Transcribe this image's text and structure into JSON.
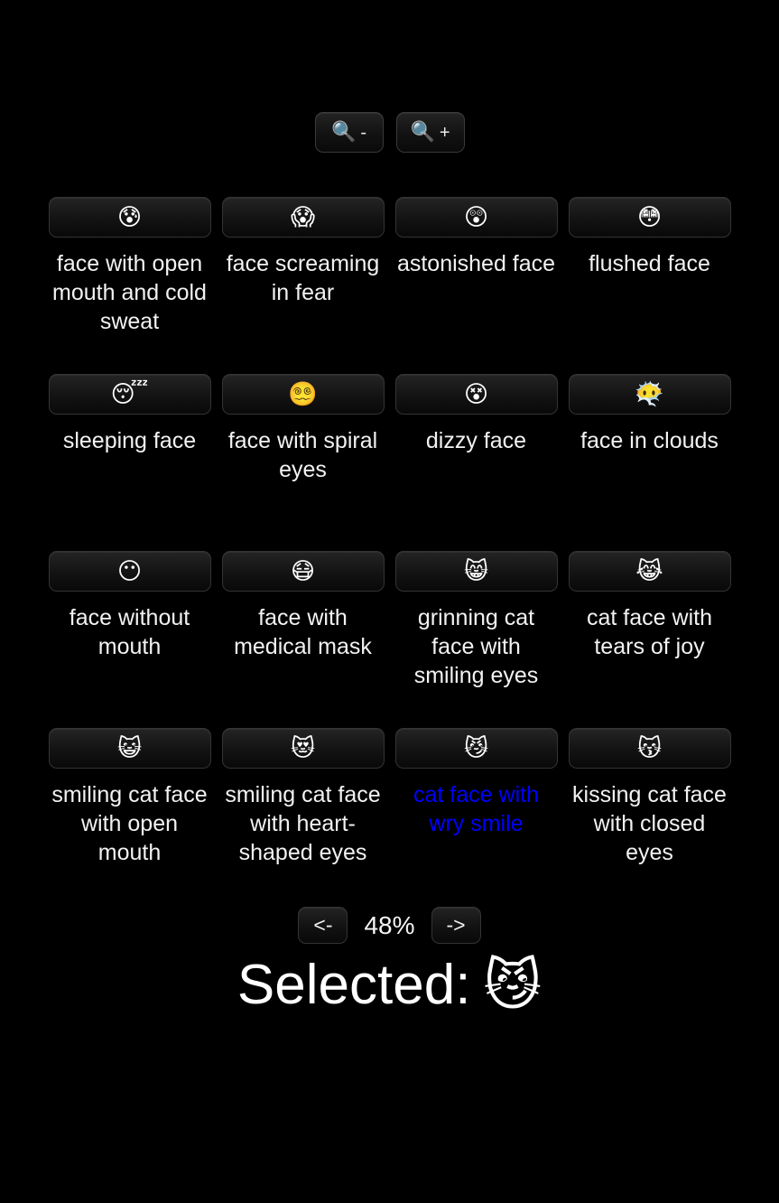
{
  "background_color": "#000000",
  "text_color": "#f2f2f2",
  "selected_color": "#0000ff",
  "toolbar": {
    "zoom_out": {
      "icon": "magnifying-glass-icon",
      "glyph": "🔍",
      "sign": "-"
    },
    "zoom_in": {
      "icon": "magnifying-glass-icon",
      "glyph": "🔍",
      "sign": "+"
    }
  },
  "grid": {
    "columns": 4,
    "rows": [
      {
        "items": [
          {
            "emoji": "😰",
            "label": "face with open mouth and cold sweat",
            "selected": false
          },
          {
            "emoji": "😱",
            "label": "face screaming in fear",
            "selected": false
          },
          {
            "emoji": "😲",
            "label": "astonished face",
            "selected": false
          },
          {
            "emoji": "😳",
            "label": "flushed face",
            "selected": false
          }
        ]
      },
      {
        "items": [
          {
            "emoji": "😴",
            "label": "sleeping face",
            "selected": false
          },
          {
            "emoji": "😵‍💫",
            "label": "face with spiral eyes",
            "selected": false
          },
          {
            "emoji": "😵",
            "label": "dizzy face",
            "selected": false
          },
          {
            "emoji": "😶‍🌫️",
            "label": "face in clouds",
            "selected": false
          }
        ]
      },
      {
        "items": [
          {
            "emoji": "😶",
            "label": "face without mouth",
            "selected": false
          },
          {
            "emoji": "😷",
            "label": "face with medical mask",
            "selected": false
          },
          {
            "emoji": "😸",
            "label": "grinning cat face with smiling eyes",
            "selected": false
          },
          {
            "emoji": "😹",
            "label": "cat face with tears of joy",
            "selected": false
          }
        ]
      },
      {
        "items": [
          {
            "emoji": "😺",
            "label": "smiling cat face with open mouth",
            "selected": false
          },
          {
            "emoji": "😻",
            "label": "smiling cat face with heart-shaped eyes",
            "selected": false
          },
          {
            "emoji": "😼",
            "label": "cat face with wry smile",
            "selected": true
          },
          {
            "emoji": "😽",
            "label": "kissing cat face with closed eyes",
            "selected": false
          }
        ]
      }
    ]
  },
  "pager": {
    "prev_label": "<-",
    "percent_label": "48%",
    "next_label": "->"
  },
  "selection": {
    "label": "Selected:",
    "emoji": "😼"
  }
}
